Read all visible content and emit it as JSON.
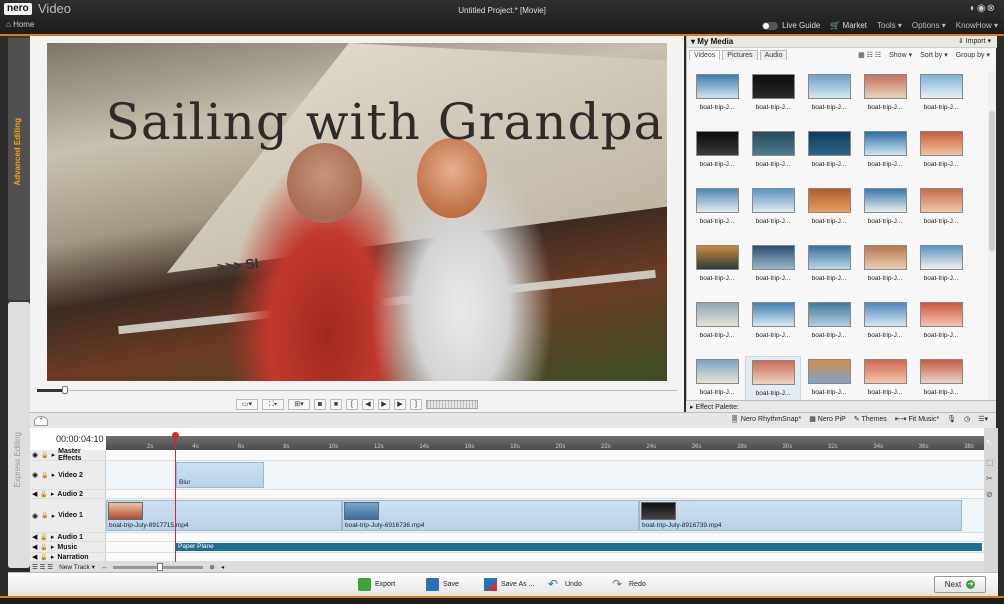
{
  "app": {
    "logo": "nero",
    "name": "Video",
    "breadcrumb": "Home",
    "project_title": "Untitled Project.* [Movie]",
    "window_controls": "◐◉⊗"
  },
  "topbar": {
    "live_guide": "Live Guide",
    "market": "Market",
    "tools": "Tools ▾",
    "options": "Options ▾",
    "knowhow": "KnowHow ▾"
  },
  "sidetabs": {
    "advanced": "Advanced Editing",
    "express": "Express Editing"
  },
  "preview": {
    "title_text": "Sailing with Grandpa",
    "banner_text": ">>> SI"
  },
  "media": {
    "header": "My Media",
    "import": "Import ▾",
    "tabs": [
      "Videos",
      "Pictures",
      "Audio"
    ],
    "show": "Show ▾",
    "sort_by": "Sort by ▾",
    "group_by": "Group by ▾",
    "thumbs": [
      {
        "label": "boat-trip-J...",
        "c1": "#3a7fb0",
        "c2": "#cfe3ee"
      },
      {
        "label": "boat-trip-J...",
        "c1": "#0d0d0d",
        "c2": "#2a2a2a"
      },
      {
        "label": "boat-trip-J...",
        "c1": "#6fa0c8",
        "c2": "#d5e7f0"
      },
      {
        "label": "boat-trip-J...",
        "c1": "#c87060",
        "c2": "#e5d2b8"
      },
      {
        "label": "boat-trip-J...",
        "c1": "#7fb3d6",
        "c2": "#e8f0f4"
      },
      {
        "label": "boat-trip-J...",
        "c1": "#0b0b0b",
        "c2": "#3a3a3a"
      },
      {
        "label": "boat-trip-J...",
        "c1": "#284a5e",
        "c2": "#4d7a8f"
      },
      {
        "label": "boat-trip-J...",
        "c1": "#123a5c",
        "c2": "#2e6588"
      },
      {
        "label": "boat-trip-J...",
        "c1": "#2b6fa0",
        "c2": "#cfe4f0"
      },
      {
        "label": "boat-trip-J...",
        "c1": "#c85f3a",
        "c2": "#f0c3a0"
      },
      {
        "label": "boat-trip-J...",
        "c1": "#4f88b3",
        "c2": "#e4ecef"
      },
      {
        "label": "boat-trip-J...",
        "c1": "#5b95c0",
        "c2": "#dfe9ee"
      },
      {
        "label": "boat-trip-J...",
        "c1": "#b05c2e",
        "c2": "#e6a060"
      },
      {
        "label": "boat-trip-J...",
        "c1": "#3a78a8",
        "c2": "#e8eef0"
      },
      {
        "label": "boat-trip-J...",
        "c1": "#c96b4d",
        "c2": "#f0c7a8"
      },
      {
        "label": "boat-trip-J...",
        "c1": "#c88b3a",
        "c2": "#2d3a3c"
      },
      {
        "label": "boat-trip-J...",
        "c1": "#2a4f73",
        "c2": "#9bb6c8"
      },
      {
        "label": "boat-trip-J...",
        "c1": "#3b6f9a",
        "c2": "#bcd6e6"
      },
      {
        "label": "boat-trip-J...",
        "c1": "#b87650",
        "c2": "#e9d0b6"
      },
      {
        "label": "boat-trip-J...",
        "c1": "#5c94c2",
        "c2": "#f0f0ee"
      },
      {
        "label": "boat-trip-J...",
        "c1": "#8fa7b5",
        "c2": "#e6e2d8"
      },
      {
        "label": "boat-trip-J...",
        "c1": "#3d7fb0",
        "c2": "#d9e9f2"
      },
      {
        "label": "boat-trip-J...",
        "c1": "#3f7a9e",
        "c2": "#b2cfe0"
      },
      {
        "label": "boat-trip-J...",
        "c1": "#4a8ac0",
        "c2": "#d8e6ee"
      },
      {
        "label": "boat-trip-J...",
        "c1": "#d0573d",
        "c2": "#f0c6b0"
      },
      {
        "label": "boat-trip-J...",
        "c1": "#7aa4c0",
        "c2": "#e9e2d6"
      },
      {
        "label": "boat-trip-J...",
        "c1": "#c96a54",
        "c2": "#f0d4c0"
      },
      {
        "label": "boat-trip-J...",
        "c1": "#d28d4c",
        "c2": "#7aa6c6"
      },
      {
        "label": "boat-trip-J...",
        "c1": "#d0684f",
        "c2": "#f2c5ab"
      },
      {
        "label": "boat-trip-J...",
        "c1": "#c65c42",
        "c2": "#e8d3c3"
      }
    ]
  },
  "effect_palette": "Effect Palette:",
  "timeline_tools": {
    "rhythm": "Nero RhythmSnap*",
    "pip": "Nero PiP",
    "themes": "Themes",
    "fitmusic": "Fit Music*"
  },
  "timeline": {
    "timecode": "00:00:04:10",
    "ticks": [
      "2s",
      "4s",
      "6s",
      "8s",
      "10s",
      "12s",
      "14s",
      "16s",
      "18s",
      "20s",
      "22s",
      "24s",
      "26s",
      "28s",
      "30s",
      "32s",
      "34s",
      "36s",
      "38s"
    ],
    "tracks": [
      "Master Effects",
      "Video 2",
      "Audio 2",
      "Video 1",
      "Audio 1",
      "Music",
      "Narration"
    ],
    "blur_clip": "Blur",
    "clips": [
      "boat-trip-July-8917715.mp4",
      "boat-trip-July-6916736.mp4",
      "boat-trip-July-8916739.mp4"
    ],
    "music_clip": "Paper Plane"
  },
  "bottom_toolbar": {
    "new_track": "New Track ▾"
  },
  "footer": {
    "export": "Export",
    "save": "Save",
    "save_as": "Save As ...",
    "undo": "Undo",
    "redo": "Redo",
    "next": "Next"
  }
}
